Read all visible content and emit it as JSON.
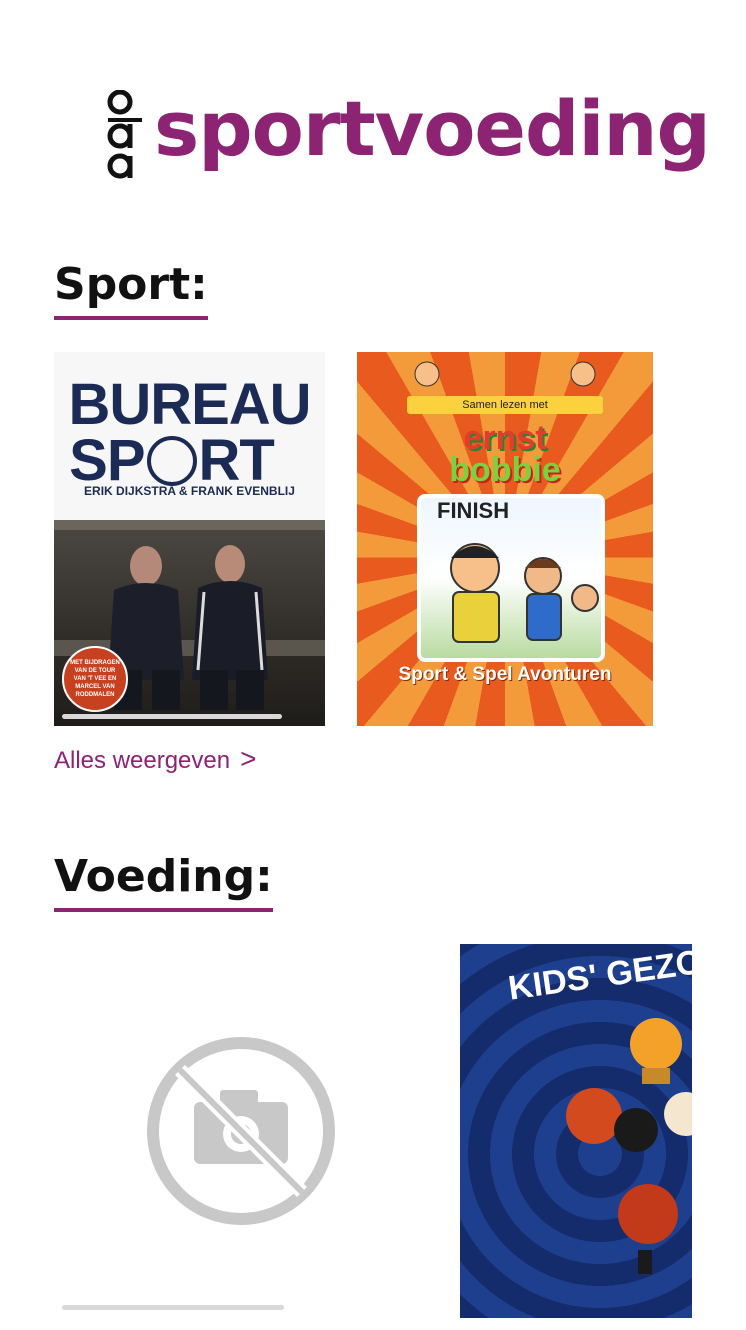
{
  "header": {
    "logo_letters": [
      "o",
      "b",
      "a"
    ],
    "title": "sportvoeding",
    "brand_color": "#8d2373"
  },
  "sport": {
    "heading": "Sport:",
    "books": [
      {
        "title_lines": [
          "BUREAU",
          "SP",
          "RT"
        ],
        "authors": "ERIK DIJKSTRA & FRANK EVENBLIJ",
        "badge": "MET BIJDRAGEN VAN DE TOUR VAN 'T VEE EN MARCEL VAN RODDMALEN"
      },
      {
        "band": "Samen lezen met",
        "title_lines": [
          "ernst",
          "bobbie"
        ],
        "finish": "FINISH",
        "subtitle": "Sport & Spel Avonturen"
      }
    ],
    "show_all_label": "Alles weergeven",
    "show_all_chevron": ">"
  },
  "voeding": {
    "heading": "Voeding:",
    "books": [
      {
        "image": "no-image-placeholder-icon"
      },
      {
        "title": "KIDS' GEZON"
      }
    ]
  }
}
